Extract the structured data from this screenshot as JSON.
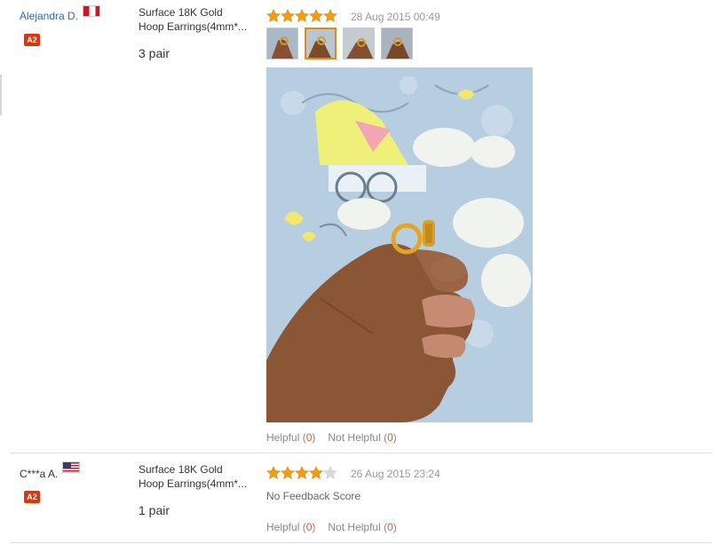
{
  "reviews": [
    {
      "user": "Alejandra D.",
      "country": "pe",
      "level_badge": "A2",
      "product_line1": "Surface 18K Gold",
      "product_line2": "Hoop Earrings(4mm*...",
      "quantity": "3 pair",
      "rating": 5,
      "date": "28 Aug 2015 00:49",
      "helpful_label": "Helpful",
      "helpful_count": "0",
      "not_helpful_label": "Not Helpful",
      "not_helpful_count": "0",
      "open": "(",
      "close": ")"
    },
    {
      "user": "C***a A.",
      "country": "us",
      "level_badge": "A2",
      "product_line1": "Surface 18K Gold",
      "product_line2": "Hoop Earrings(4mm*...",
      "quantity": "1 pair",
      "rating": 4,
      "date": "26 Aug 2015 23:24",
      "feedback": "No Feedback Score",
      "helpful_label": "Helpful",
      "helpful_count": "0",
      "not_helpful_label": "Not Helpful",
      "not_helpful_count": "0",
      "open": "(",
      "close": ")"
    }
  ],
  "colors": {
    "star_on": "#f39c12",
    "star_off": "#d8d8d8",
    "link": "#2a6bb0",
    "badge": "#d9380f",
    "count": "#e05a1c"
  }
}
